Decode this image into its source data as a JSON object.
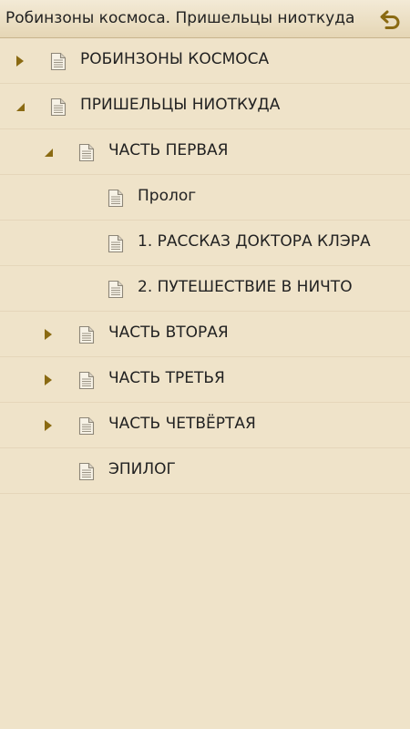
{
  "header": {
    "title": "Робинзоны космоса. Пришельцы ниоткуда",
    "back_icon": "back-arrow-icon"
  },
  "colors": {
    "background": "#efe3c9",
    "header": "#e9dcc0",
    "arrow": "#8a6a12",
    "text": "#222222"
  },
  "toc": {
    "items": [
      {
        "label": "РОБИНЗОНЫ КОСМОСА",
        "level": 0,
        "state": "collapsed"
      },
      {
        "label": "ПРИШЕЛЬЦЫ НИОТКУДА",
        "level": 0,
        "state": "expanded"
      },
      {
        "label": "ЧАСТЬ ПЕРВАЯ",
        "level": 1,
        "state": "expanded"
      },
      {
        "label": "Пролог",
        "level": 2,
        "state": "leaf"
      },
      {
        "label": "1. РАССКАЗ ДОКТОРА КЛЭРА",
        "level": 2,
        "state": "leaf"
      },
      {
        "label": "2. ПУТЕШЕСТВИЕ В НИЧТО",
        "level": 2,
        "state": "leaf"
      },
      {
        "label": "ЧАСТЬ ВТОРАЯ",
        "level": 1,
        "state": "collapsed"
      },
      {
        "label": "ЧАСТЬ ТРЕТЬЯ",
        "level": 1,
        "state": "collapsed"
      },
      {
        "label": "ЧАСТЬ ЧЕТВЁРТАЯ",
        "level": 1,
        "state": "collapsed"
      },
      {
        "label": "ЭПИЛОГ",
        "level": 1,
        "state": "leaf"
      }
    ]
  }
}
